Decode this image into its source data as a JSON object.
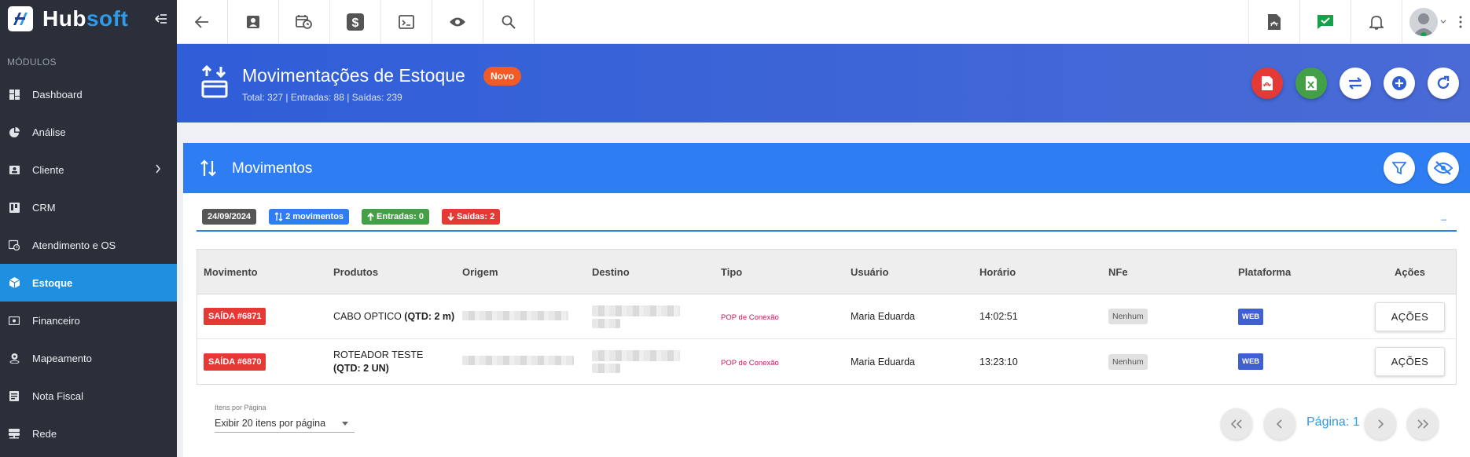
{
  "app": {
    "logo_hub": "Hub",
    "logo_soft": "soft"
  },
  "sidebar": {
    "section_title": "MÓDULOS",
    "items": [
      {
        "label": "Dashboard",
        "icon": "dashboard-icon"
      },
      {
        "label": "Análise",
        "icon": "pie-chart-icon"
      },
      {
        "label": "Cliente",
        "icon": "contact-icon"
      },
      {
        "label": "CRM",
        "icon": "crm-board-icon"
      },
      {
        "label": "Atendimento e OS",
        "icon": "calendar-clock-icon"
      },
      {
        "label": "Estoque",
        "icon": "box-icon",
        "active": true
      },
      {
        "label": "Financeiro",
        "icon": "money-icon"
      },
      {
        "label": "Mapeamento",
        "icon": "map-pin-icon"
      },
      {
        "label": "Nota Fiscal",
        "icon": "invoice-icon"
      },
      {
        "label": "Rede",
        "icon": "network-icon"
      }
    ]
  },
  "header": {
    "title": "Movimentações de Estoque",
    "badge": "Novo",
    "subtitle": "Total: 327 | Entradas: 88 | Saídas: 239"
  },
  "card": {
    "title": "Movimentos",
    "chips": {
      "date": "24/09/2024",
      "movimentos": "2 movimentos",
      "entradas": "Entradas: 0",
      "saidas": "Saídas: 2"
    },
    "collapse": "–"
  },
  "table": {
    "headers": [
      "Movimento",
      "Produtos",
      "Origem",
      "Destino",
      "Tipo",
      "Usuário",
      "Horário",
      "NFe",
      "Plataforma",
      "Ações"
    ],
    "rows": [
      {
        "movimento": "SAÍDA #6871",
        "produto": "CABO OPTICO ",
        "qtd": "(QTD: 2 m)",
        "tipo": "POP de Conexão",
        "usuario": "Maria Eduarda",
        "horario": "14:02:51",
        "nfe": "Nenhum",
        "plataforma": "WEB",
        "acao": "AÇÕES"
      },
      {
        "movimento": "SAÍDA #6870",
        "produto": "ROTEADOR TESTE ",
        "qtd": "(QTD: 2 UN)",
        "tipo": "POP de Conexão",
        "usuario": "Maria Eduarda",
        "horario": "13:23:10",
        "nfe": "Nenhum",
        "plataforma": "WEB",
        "acao": "AÇÕES"
      }
    ]
  },
  "pagination": {
    "items_label": "Itens por Página",
    "items_value": "Exibir 20 itens por página",
    "page_label": "Página: 1"
  },
  "colors": {
    "sidebar_bg": "#2b2f3a",
    "active": "#1f8fe0",
    "banner": "#3a62d8",
    "card_head": "#2e7df2",
    "saida": "#e53935",
    "entrada": "#43a047",
    "novo": "#f05b27"
  }
}
